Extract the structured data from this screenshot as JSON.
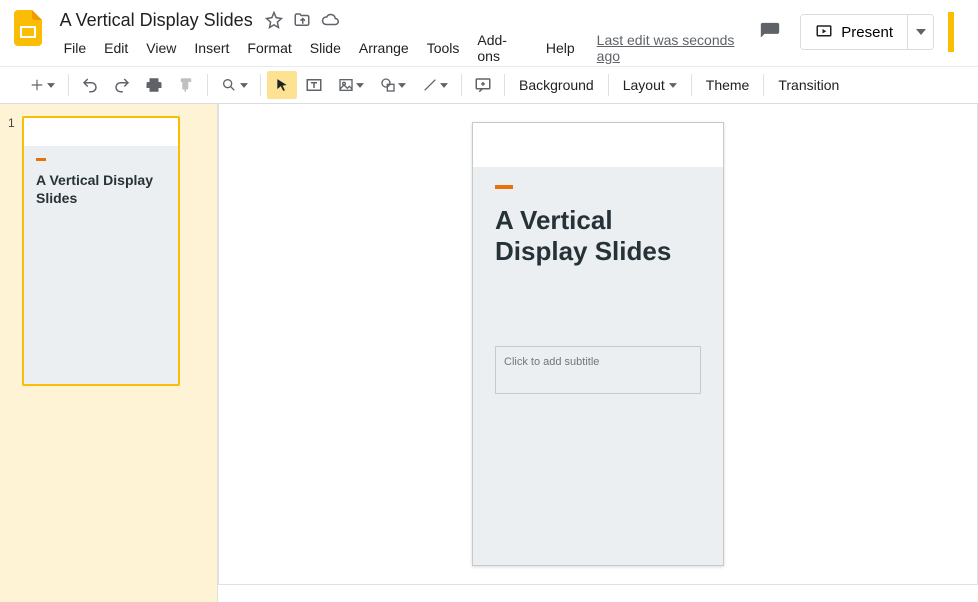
{
  "header": {
    "doc_title": "A Vertical Display Slides",
    "menus": [
      "File",
      "Edit",
      "View",
      "Insert",
      "Format",
      "Slide",
      "Arrange",
      "Tools",
      "Add-ons",
      "Help"
    ],
    "last_edit": "Last edit was seconds ago",
    "present_label": "Present"
  },
  "toolbar": {
    "background": "Background",
    "layout": "Layout",
    "theme": "Theme",
    "transition": "Transition"
  },
  "filmstrip": {
    "slide_number": "1",
    "thumb_title": "A Vertical Display Slides"
  },
  "slide": {
    "title": "A Vertical Display Slides",
    "subtitle_placeholder": "Click to add subtitle"
  }
}
